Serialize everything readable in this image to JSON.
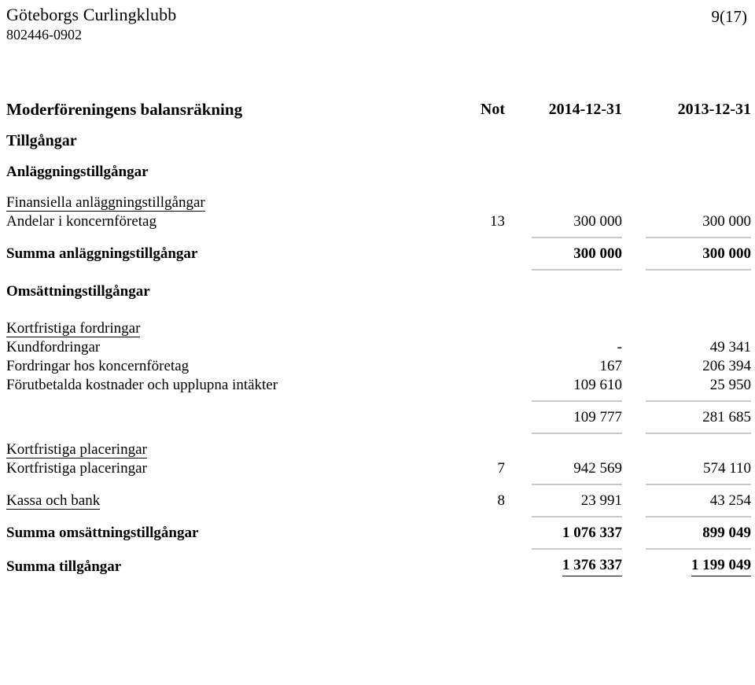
{
  "header": {
    "organization_name": "Göteborgs Curlingklubb",
    "organization_number": "802446-0902",
    "page_number": "9(17)"
  },
  "statement": {
    "title": "Moderföreningens balansräkning",
    "col_note": "Not",
    "col_current": "2014-12-31",
    "col_previous": "2013-12-31",
    "section_assets": "Tillgångar",
    "section_fixed_assets": "Anläggningstillgångar",
    "group_financial_fixed_assets": "Finansiella anläggningstillgångar",
    "rows": [
      {
        "label": "Andelar i koncernföretag",
        "note": "13",
        "current": "300 000",
        "previous": "300 000"
      },
      {
        "label": "Summa anläggningstillgångar",
        "note": "",
        "current": "300 000",
        "previous": "300 000"
      },
      {
        "label": "Kundfordringar",
        "note": "",
        "current": "-",
        "previous": "49 341"
      },
      {
        "label": "Fordringar hos koncernföretag",
        "note": "",
        "current": "167",
        "previous": "206 394"
      },
      {
        "label": "Förutbetalda kostnader och upplupna intäkter",
        "note": "",
        "current": "109 610",
        "previous": "25 950"
      },
      {
        "label": "",
        "note": "",
        "current": "109 777",
        "previous": "281 685"
      },
      {
        "label": "Kortfristiga placeringar",
        "note": "7",
        "current": "942 569",
        "previous": "574 110"
      },
      {
        "label": "Kassa och bank",
        "note": "8",
        "current": "23 991",
        "previous": "43 254"
      },
      {
        "label": "Summa omsättningstillgångar",
        "note": "",
        "current": "1 076 337",
        "previous": "899 049"
      },
      {
        "label": "Summa tillgångar",
        "note": "",
        "current": "1 376 337",
        "previous": "1 199 049"
      }
    ],
    "section_current_assets": "Omsättningstillgångar",
    "group_short_term_receivables": "Kortfristiga fordringar",
    "group_short_term_investments": "Kortfristiga placeringar"
  }
}
